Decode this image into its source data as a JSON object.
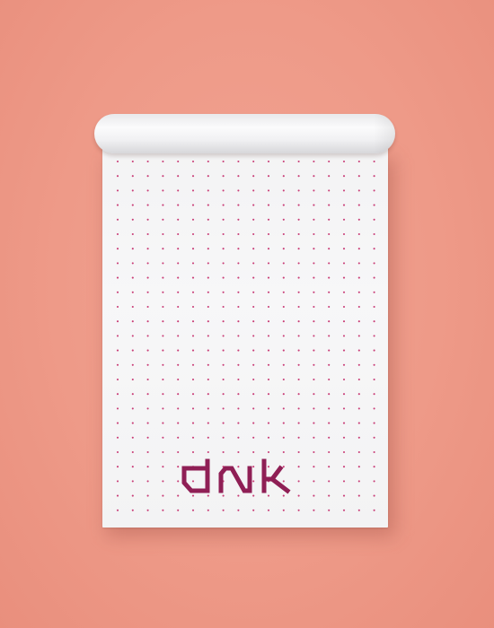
{
  "scene": {
    "background_color": "#ee9b89",
    "paper_color": "#f5f5f6",
    "dot_color": "#c93d77"
  },
  "logo": {
    "text": "dnk",
    "color": "#8f1f55"
  }
}
